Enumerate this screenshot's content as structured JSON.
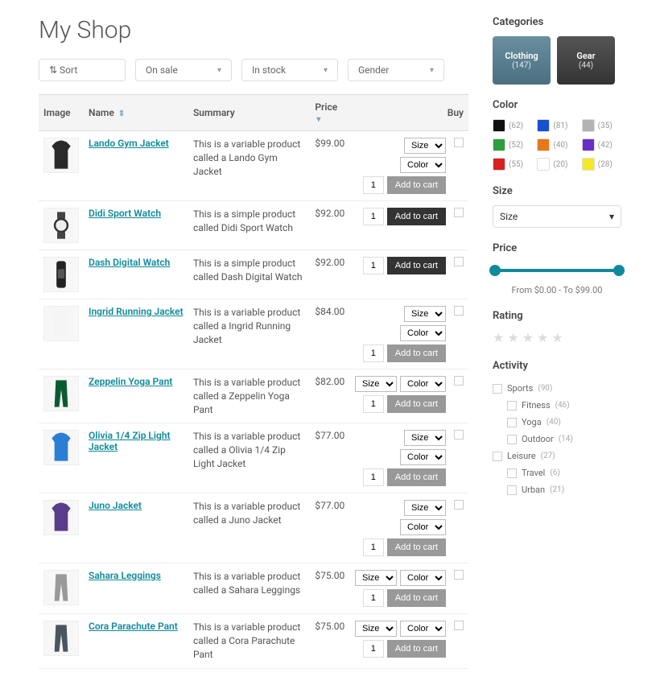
{
  "title": "My Shop",
  "filters": {
    "sort": "Sort",
    "on_sale": "On sale",
    "in_stock": "In stock",
    "gender": "Gender"
  },
  "table": {
    "headers": {
      "image": "Image",
      "name": "Name",
      "summary": "Summary",
      "price": "Price",
      "buy": "Buy"
    },
    "rows": [
      {
        "name": "Lando Gym Jacket",
        "summary": "This is a variable product called a Lando Gym Jacket",
        "price": "$99.00",
        "variants": [
          "Size",
          "Color"
        ],
        "variant_layout": "stack",
        "thumb_color": "#2a2a2a",
        "thumb_type": "jacket"
      },
      {
        "name": "Didi Sport Watch",
        "summary": "This is a simple product called Didi Sport Watch",
        "price": "$92.00",
        "variants": [],
        "thumb_color": "#333",
        "thumb_type": "watch"
      },
      {
        "name": "Dash Digital Watch",
        "summary": "This is a simple product called Dash Digital Watch",
        "price": "$92.00",
        "variants": [],
        "thumb_color": "#222",
        "thumb_type": "watch2"
      },
      {
        "name": "Ingrid Running Jacket",
        "summary": "This is a variable product called a Ingrid Running Jacket",
        "price": "$84.00",
        "variants": [
          "Size",
          "Color"
        ],
        "variant_layout": "stack",
        "thumb_color": "#f5f5f5",
        "thumb_type": "jacket"
      },
      {
        "name": "Zeppelin Yoga Pant",
        "summary": "This is a variable product called a Zeppelin Yoga Pant",
        "price": "$82.00",
        "variants": [
          "Size",
          "Color"
        ],
        "variant_layout": "row",
        "thumb_color": "#0a5c2e",
        "thumb_type": "pants"
      },
      {
        "name": "Olivia 1/4 Zip Light Jacket",
        "summary": "This is a variable product called a Olivia 1/4 Zip Light Jacket",
        "price": "$77.00",
        "variants": [
          "Size",
          "Color"
        ],
        "variant_layout": "stack",
        "thumb_color": "#2a7fd4",
        "thumb_type": "jacket"
      },
      {
        "name": "Juno Jacket",
        "summary": "This is a variable product called a Juno Jacket",
        "price": "$77.00",
        "variants": [
          "Size",
          "Color"
        ],
        "variant_layout": "stack",
        "thumb_color": "#5a3d8a",
        "thumb_type": "jacket"
      },
      {
        "name": "Sahara Leggings",
        "summary": "This is a variable product called a Sahara Leggings",
        "price": "$75.00",
        "variants": [
          "Size",
          "Color"
        ],
        "variant_layout": "row",
        "thumb_color": "#999",
        "thumb_type": "pants"
      },
      {
        "name": "Cora Parachute Pant",
        "summary": "This is a variable product called a Cora Parachute Pant",
        "price": "$75.00",
        "variants": [
          "Size",
          "Color"
        ],
        "variant_layout": "row",
        "thumb_color": "#4a5560",
        "thumb_type": "pants"
      }
    ],
    "qty_default": "1",
    "add_to_cart": "Add to cart"
  },
  "sidebar": {
    "categories_h": "Categories",
    "categories": [
      {
        "name": "Clothing",
        "count": "(147)",
        "cls": "clothing"
      },
      {
        "name": "Gear",
        "count": "(44)",
        "cls": "gear"
      }
    ],
    "color_h": "Color",
    "colors": [
      {
        "hex": "#111111",
        "count": "(62)"
      },
      {
        "hex": "#1a4fd4",
        "count": "(81)"
      },
      {
        "hex": "#b3b3b3",
        "count": "(35)"
      },
      {
        "hex": "#2e9e3f",
        "count": "(52)"
      },
      {
        "hex": "#e67817",
        "count": "(40)"
      },
      {
        "hex": "#6a2fc9",
        "count": "(42)"
      },
      {
        "hex": "#d92020",
        "count": "(55)"
      },
      {
        "hex": "#ffffff",
        "count": "(20)"
      },
      {
        "hex": "#f5e925",
        "count": "(28)"
      }
    ],
    "size_h": "Size",
    "size_placeholder": "Size",
    "price_h": "Price",
    "price_label": "From $0.00 - To $99.00",
    "rating_h": "Rating",
    "activity_h": "Activity",
    "activities": [
      {
        "label": "Sports",
        "count": "(90)",
        "sub": false
      },
      {
        "label": "Fitness",
        "count": "(46)",
        "sub": true
      },
      {
        "label": "Yoga",
        "count": "(40)",
        "sub": true
      },
      {
        "label": "Outdoor",
        "count": "(14)",
        "sub": true
      },
      {
        "label": "Leisure",
        "count": "(27)",
        "sub": false
      },
      {
        "label": "Travel",
        "count": "(6)",
        "sub": true
      },
      {
        "label": "Urban",
        "count": "(21)",
        "sub": true
      }
    ]
  }
}
